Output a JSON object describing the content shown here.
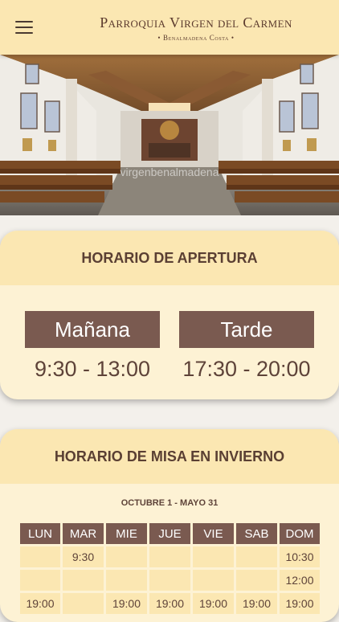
{
  "header": {
    "title": "Parroquia Virgen del Carmen",
    "subtitle": "• Benalmadena Costa •"
  },
  "hero": {
    "watermark": "virgenbenalmadena"
  },
  "opening": {
    "title": "HORARIO DE APERTURA",
    "morning": {
      "label": "Mañana",
      "time": "9:30 - 13:00"
    },
    "afternoon": {
      "label": "Tarde",
      "time": "17:30 - 20:00"
    }
  },
  "mass": {
    "title": "HORARIO DE MISA EN INVIERNO",
    "season": "OCTUBRE 1 - MAYO 31",
    "days": [
      "LUN",
      "MAR",
      "MIE",
      "JUE",
      "VIE",
      "SAB",
      "DOM"
    ],
    "rows": [
      [
        "",
        "9:30",
        "",
        "",
        "",
        "",
        "10:30"
      ],
      [
        "",
        "",
        "",
        "",
        "",
        "",
        "12:00"
      ],
      [
        "19:00",
        "",
        "19:00",
        "19:00",
        "19:00",
        "19:00",
        "19:00"
      ]
    ]
  },
  "colors": {
    "header_bg": "#fbe7b2",
    "card_bg": "#fdf2d4",
    "accent_brown": "#7a5a50",
    "text_brown": "#5a3f33"
  }
}
